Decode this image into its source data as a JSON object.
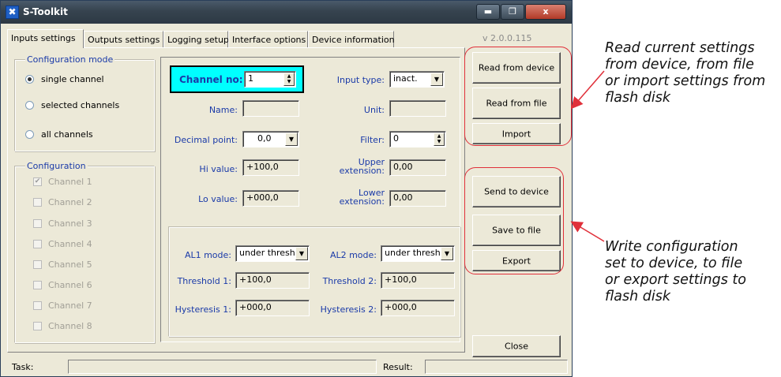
{
  "window": {
    "title": "S-Toolkit",
    "app_icon": "tools-icon",
    "controls": {
      "minimize": "▬",
      "maximize": "❐",
      "close": "x"
    }
  },
  "tabs": [
    {
      "label": "Inputs settings",
      "active": true
    },
    {
      "label": "Outputs settings",
      "active": false
    },
    {
      "label": "Logging setup",
      "active": false
    },
    {
      "label": "Interface options",
      "active": false
    },
    {
      "label": "Device information",
      "active": false
    }
  ],
  "version": "v 2.0.0.115",
  "config_mode": {
    "legend": "Configuration mode",
    "options": [
      {
        "label": "single channel",
        "selected": true
      },
      {
        "label": "selected channels",
        "selected": false
      },
      {
        "label": "all channels",
        "selected": false
      }
    ]
  },
  "configuration": {
    "legend": "Configuration",
    "channels": [
      {
        "label": "Channel 1",
        "checked": true
      },
      {
        "label": "Channel 2",
        "checked": false
      },
      {
        "label": "Channel 3",
        "checked": false
      },
      {
        "label": "Channel 4",
        "checked": false
      },
      {
        "label": "Channel 5",
        "checked": false
      },
      {
        "label": "Channel 6",
        "checked": false
      },
      {
        "label": "Channel 7",
        "checked": false
      },
      {
        "label": "Channel 8",
        "checked": false
      }
    ]
  },
  "settings": {
    "channel_no_label": "Channel no:",
    "channel_no_value": "1",
    "input_type_label": "Input type:",
    "input_type_value": "inact.",
    "name_label": "Name:",
    "name_value": "",
    "unit_label": "Unit:",
    "unit_value": "",
    "decimal_point_label": "Decimal point:",
    "decimal_point_value": "0,0",
    "filter_label": "Filter:",
    "filter_value": "0",
    "hi_value_label": "Hi value:",
    "hi_value": "+100,0",
    "upper_extension_label_1": "Upper",
    "upper_extension_label_2": "extension:",
    "upper_extension_value": "0,00",
    "lo_value_label": "Lo value:",
    "lo_value": "+000,0",
    "lower_extension_label_1": "Lower",
    "lower_extension_label_2": "extension:",
    "lower_extension_value": "0,00"
  },
  "alarms": {
    "al1_mode_label": "AL1 mode:",
    "al1_mode_value": "under thresh.",
    "al2_mode_label": "AL2 mode:",
    "al2_mode_value": "under thresh.",
    "threshold1_label": "Threshold 1:",
    "threshold1_value": "+100,0",
    "threshold2_label": "Threshold 2:",
    "threshold2_value": "+100,0",
    "hysteresis1_label": "Hysteresis 1:",
    "hysteresis1_value": "+000,0",
    "hysteresis2_label": "Hysteresis 2:",
    "hysteresis2_value": "+000,0"
  },
  "buttons": {
    "read_from_device": "Read from device",
    "read_from_file": "Read from file",
    "import": "Import",
    "send_to_device": "Send to device",
    "save_to_file": "Save to file",
    "export": "Export",
    "close": "Close"
  },
  "status": {
    "task_label": "Task:",
    "task_value": "",
    "result_label": "Result:",
    "result_value": ""
  },
  "annotations": {
    "read": "Read current settings\nfrom device, from file\nor import settings from\nflash disk",
    "write": "Write configuration\nset to device, to file\nor export settings to\nflash disk"
  },
  "colors": {
    "highlight_box": "#00ffff",
    "label_blue": "#1a3aa8",
    "callout_red": "#e0303a"
  }
}
